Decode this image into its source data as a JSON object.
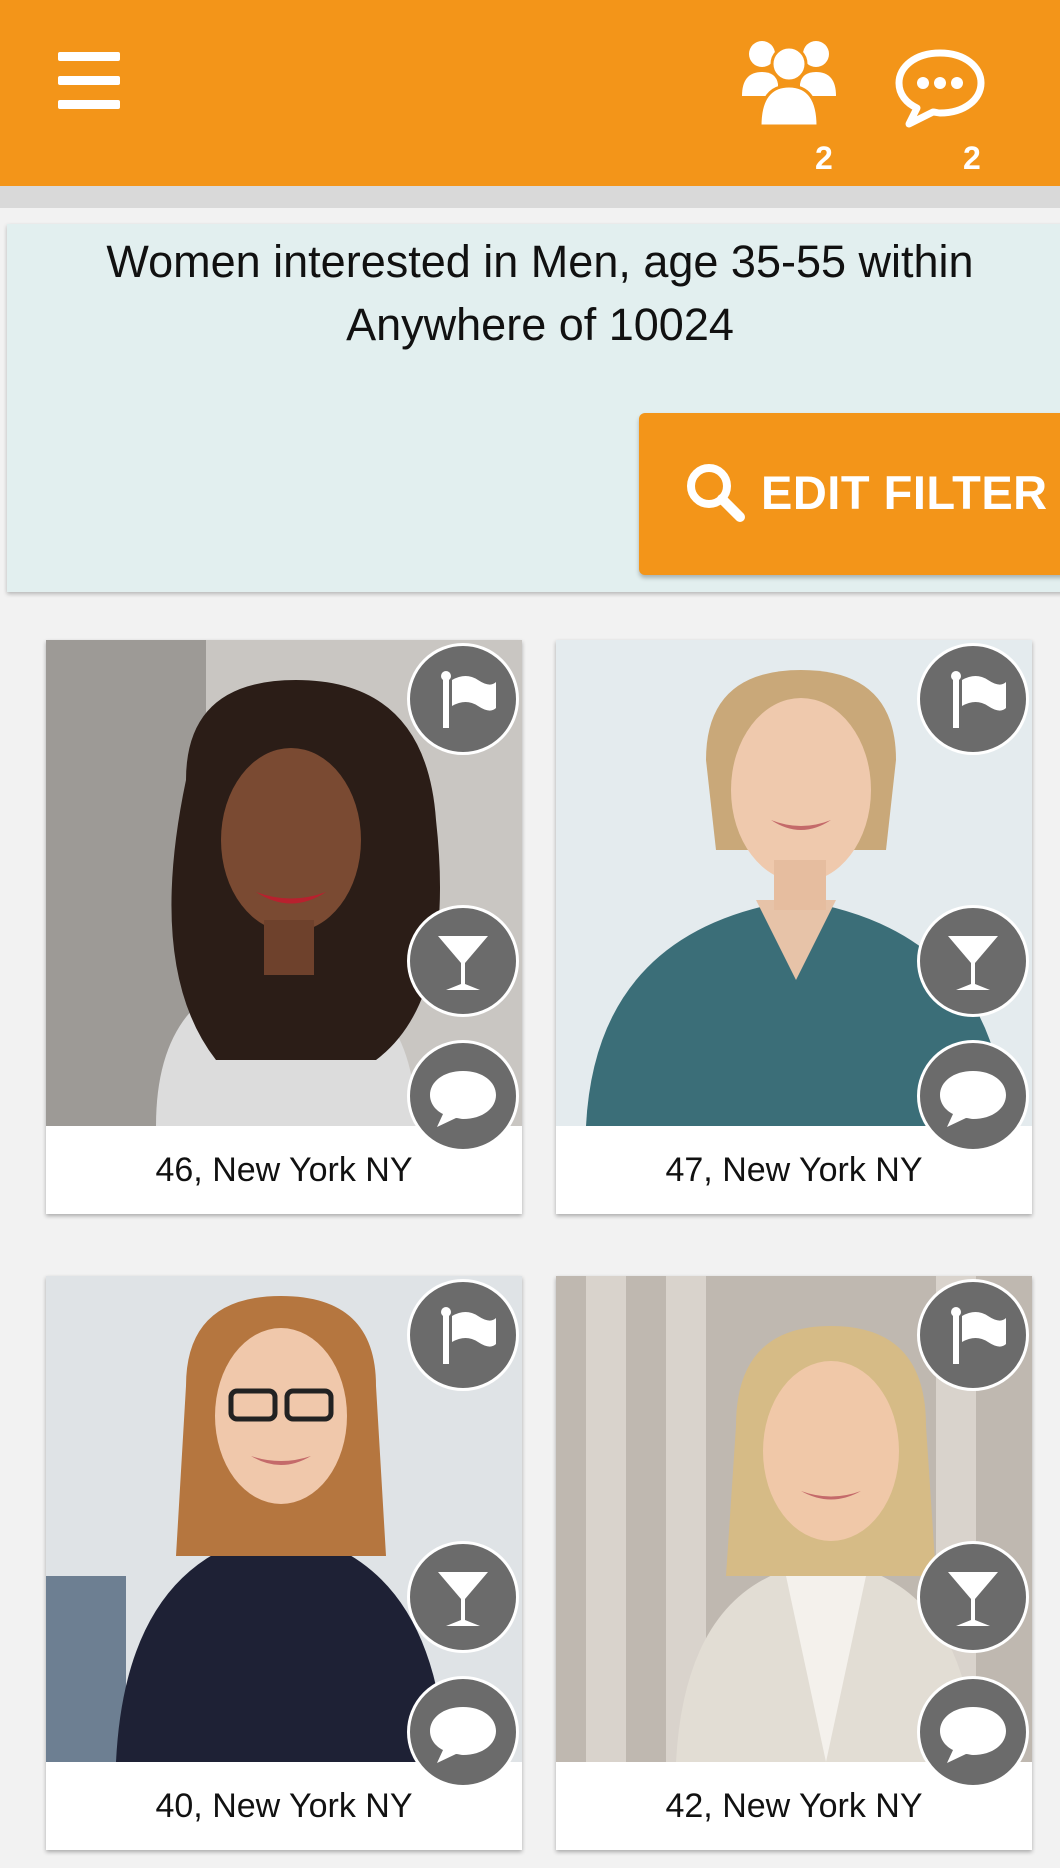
{
  "header": {
    "menu_icon": "hamburger-menu-icon",
    "people_icon": "people-group-icon",
    "people_count": "2",
    "chat_icon": "chat-bubble-icon",
    "chat_count": "2",
    "accent_color": "#f39519"
  },
  "filter": {
    "description": "Women interested in Men, age 35-55 within Anywhere of 10024",
    "button_label": "EDIT FILTER",
    "button_icon": "search-icon"
  },
  "profiles": [
    {
      "caption": "46, New York NY"
    },
    {
      "caption": "47, New York NY"
    },
    {
      "caption": "40, New York NY"
    },
    {
      "caption": "42, New York NY"
    }
  ],
  "card_actions": [
    "flag-icon",
    "cocktail-glass-icon",
    "speech-bubble-icon"
  ]
}
